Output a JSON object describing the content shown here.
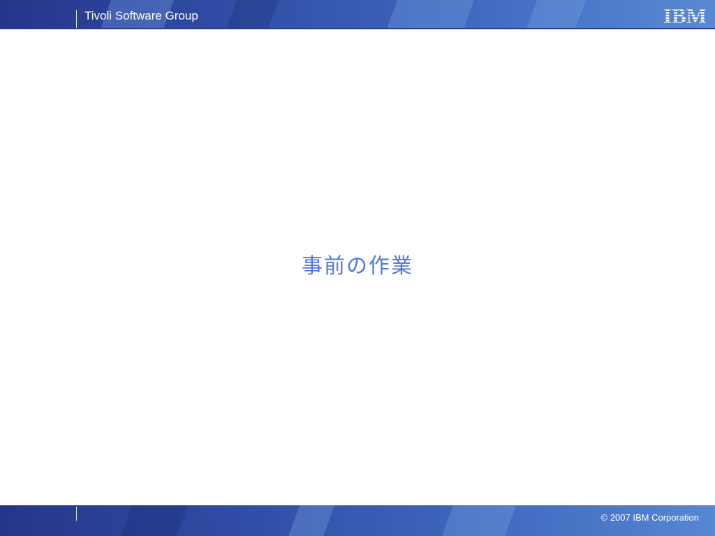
{
  "header": {
    "group_title": "Tivoli Software Group",
    "logo_icon": "ibm-logo",
    "logo_text": "IBM"
  },
  "slide": {
    "title": "事前の作業"
  },
  "footer": {
    "copyright": "© 2007 IBM Corporation"
  },
  "colors": {
    "band_dark": "#26358a",
    "band_light": "#5a89d2",
    "title_text": "#4f78e0"
  }
}
